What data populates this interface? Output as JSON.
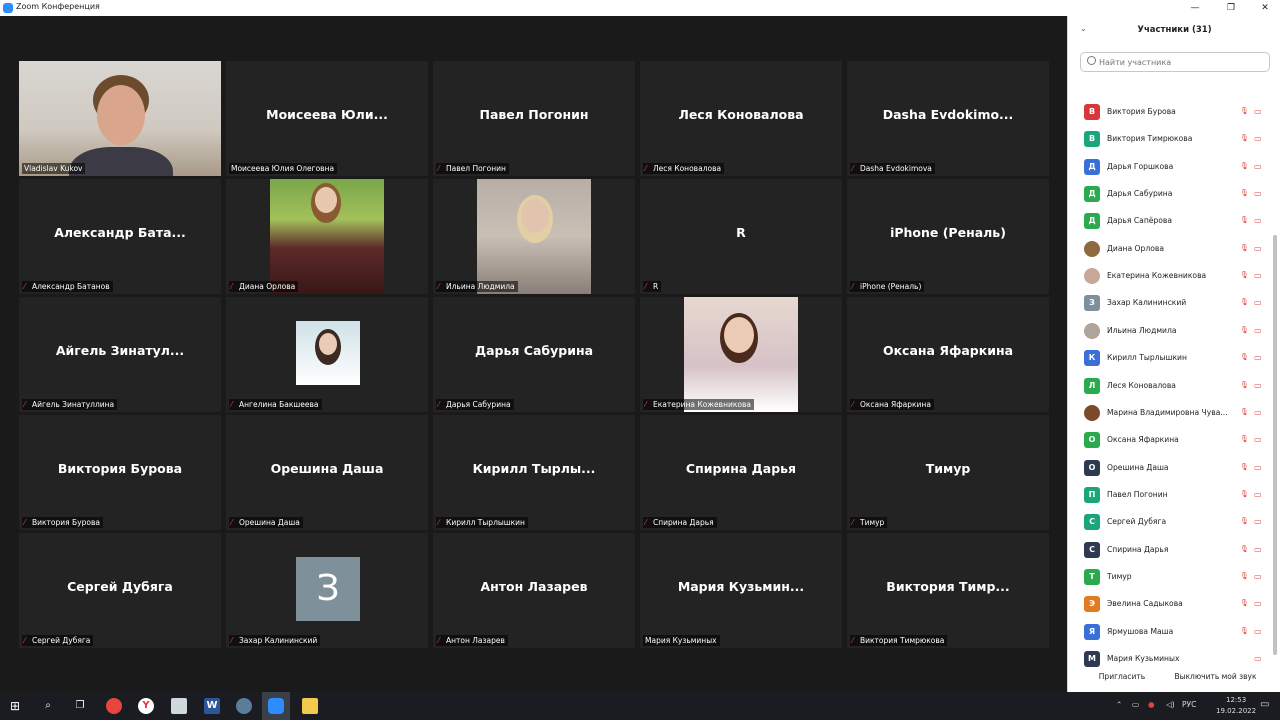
{
  "window": {
    "title": "Zoom Конференция",
    "minimize": "—",
    "restore": "❐",
    "close": "✕"
  },
  "grid": [
    {
      "name": "Vladislav Kukov",
      "big": "",
      "muted": false,
      "video": true,
      "active": true
    },
    {
      "name": "Моисеева Юлия Олеговна",
      "big": "Моисеева  Юли...",
      "muted": false
    },
    {
      "name": "Павел Погонин",
      "big": "Павел Погонин",
      "muted": true
    },
    {
      "name": "Леся Коновалова",
      "big": "Леся Коновалова",
      "muted": true
    },
    {
      "name": "Dasha Evdokimova",
      "big": "Dasha  Evdokimo...",
      "muted": true
    },
    {
      "name": "Александр Батанов",
      "big": "Александр  Бата...",
      "muted": true
    },
    {
      "name": "Диана Орлова",
      "big": "",
      "muted": true,
      "photo": "orlova"
    },
    {
      "name": "Ильина Людмила",
      "big": "",
      "muted": true,
      "photo": "ilina"
    },
    {
      "name": "R",
      "big": "R",
      "muted": true
    },
    {
      "name": "iPhone (Реналь)",
      "big": "iPhone (Реналь)",
      "muted": true
    },
    {
      "name": "Айгель Зинатуллина",
      "big": "Айгель  Зинатул...",
      "muted": true
    },
    {
      "name": "Ангелина Бакшеева",
      "big": "",
      "muted": true,
      "photo": "baksheeva"
    },
    {
      "name": "Дарья Сабурина",
      "big": "Дарья Сабурина",
      "muted": true
    },
    {
      "name": "Екатерина Кожевникова",
      "big": "",
      "muted": true,
      "photo": "kozhevnikova"
    },
    {
      "name": "Оксана Яфаркина",
      "big": "Оксана Яфаркина",
      "muted": true
    },
    {
      "name": "Виктория Бурова",
      "big": "Виктория Бурова",
      "muted": true
    },
    {
      "name": "Орешина Даша",
      "big": "Орешина Даша",
      "muted": true
    },
    {
      "name": "Кирилл Тырлышкин",
      "big": "Кирилл  Тырлы...",
      "muted": true
    },
    {
      "name": "Спирина Дарья",
      "big": "Спирина Дарья",
      "muted": true
    },
    {
      "name": "Тимур",
      "big": "Тимур",
      "muted": true
    },
    {
      "name": "Сергей Дубяга",
      "big": "Сергей Дубяга",
      "muted": true
    },
    {
      "name": "Захар Калининский",
      "big": "",
      "muted": true,
      "avatar": "З"
    },
    {
      "name": "Антон Лазарев",
      "big": "Антон Лазарев",
      "muted": true
    },
    {
      "name": "Мария Кузьминых",
      "big": "Мария  Кузьмин...",
      "muted": false
    },
    {
      "name": "Виктория Тимрюкова",
      "big": "Виктория  Тимр...",
      "muted": true
    }
  ],
  "panel": {
    "title": "Участники (31)",
    "search_placeholder": "Найти участника",
    "participants": [
      {
        "initial": "В",
        "name": "Виктория Бурова",
        "color": "#d9383a"
      },
      {
        "initial": "В",
        "name": "Виктория Тимрюкова",
        "color": "#1aa57a"
      },
      {
        "initial": "Д",
        "name": "Дарья Горшкова",
        "color": "#3b6fd8"
      },
      {
        "initial": "Д",
        "name": "Дарья Сабурина",
        "color": "#2aa94e"
      },
      {
        "initial": "Д",
        "name": "Дарья Сапёрова",
        "color": "#2aa94e"
      },
      {
        "initial": "",
        "name": "Диана Орлова",
        "color": "#8c6a3d",
        "photo": true
      },
      {
        "initial": "",
        "name": "Екатерина Кожевникова",
        "color": "#c9a89a",
        "photo": true
      },
      {
        "initial": "З",
        "name": "Захар Калининский",
        "color": "#7e919a"
      },
      {
        "initial": "",
        "name": "Ильина Людмила",
        "color": "#b0a39a",
        "photo": true
      },
      {
        "initial": "К",
        "name": "Кирилл Тырлышкин",
        "color": "#3b6fd8"
      },
      {
        "initial": "Л",
        "name": "Леся Коновалова",
        "color": "#2aa94e"
      },
      {
        "initial": "",
        "name": "Марина Владимировна Чува...",
        "color": "#7a4a2a",
        "photo": true
      },
      {
        "initial": "О",
        "name": "Оксана Яфаркина",
        "color": "#2aa94e"
      },
      {
        "initial": "О",
        "name": "Орешина Даша",
        "color": "#2d3a52"
      },
      {
        "initial": "П",
        "name": "Павел Погонин",
        "color": "#1aa57a"
      },
      {
        "initial": "С",
        "name": "Сергей Дубяга",
        "color": "#1aa57a"
      },
      {
        "initial": "С",
        "name": "Спирина Дарья",
        "color": "#2d3a52"
      },
      {
        "initial": "Т",
        "name": "Тимур",
        "color": "#2aa94e"
      },
      {
        "initial": "Э",
        "name": "Эвелина Садыкова",
        "color": "#e07b1f"
      },
      {
        "initial": "Я",
        "name": "Ярмушова Маша",
        "color": "#3b6fd8"
      },
      {
        "initial": "М",
        "name": "Мария Кузьминых",
        "color": "#2d3a52",
        "unmuted": true
      }
    ],
    "invite_label": "Пригласить",
    "mute_me_label": "Выключить мой звук"
  },
  "taskbar": {
    "lang": "РУС",
    "time": "12:53",
    "date": "19.02.2022"
  }
}
